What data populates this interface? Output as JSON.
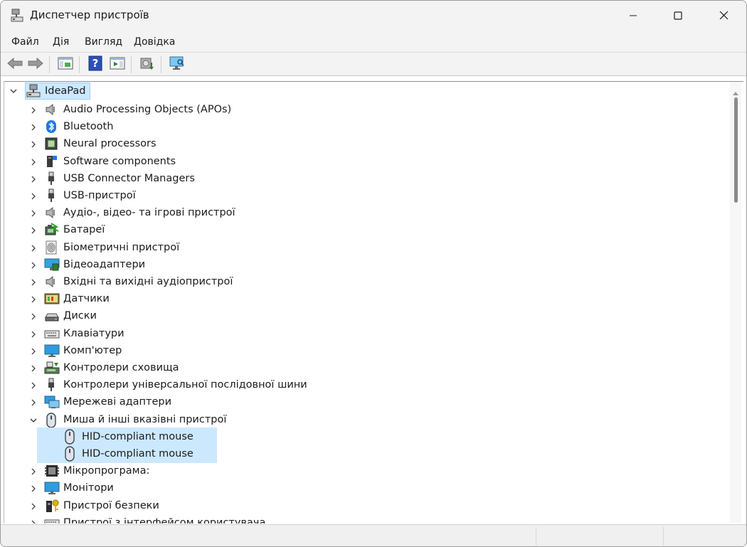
{
  "window": {
    "title": "Диспетчер пристроїв"
  },
  "menu": {
    "items": [
      "Файл",
      "Дія",
      "Вигляд",
      "Довідка"
    ]
  },
  "tree": {
    "root": {
      "label": "IdeaPad",
      "icon": "computer-network-icon"
    },
    "categories": [
      {
        "label": "Audio Processing Objects (APOs)",
        "icon": "speaker-icon",
        "expanded": false
      },
      {
        "label": "Bluetooth",
        "icon": "bluetooth-icon",
        "expanded": false
      },
      {
        "label": "Neural processors",
        "icon": "chip-icon",
        "expanded": false
      },
      {
        "label": "Software components",
        "icon": "software-component-icon",
        "expanded": false
      },
      {
        "label": "USB Connector Managers",
        "icon": "usb-icon",
        "expanded": false
      },
      {
        "label": "USB-пристрої",
        "icon": "usb-icon",
        "expanded": false
      },
      {
        "label": "Аудіо-, відео- та ігрові пристрої",
        "icon": "speaker-icon",
        "expanded": false
      },
      {
        "label": "Батареї",
        "icon": "battery-icon",
        "expanded": false
      },
      {
        "label": "Біометричні пристрої",
        "icon": "fingerprint-icon",
        "expanded": false
      },
      {
        "label": "Відеоадаптери",
        "icon": "display-adapter-icon",
        "expanded": false
      },
      {
        "label": "Вхідні та вихідні аудіопристрої",
        "icon": "speaker-icon",
        "expanded": false
      },
      {
        "label": "Датчики",
        "icon": "sensor-icon",
        "expanded": false
      },
      {
        "label": "Диски",
        "icon": "disk-icon",
        "expanded": false
      },
      {
        "label": "Клавіатури",
        "icon": "keyboard-icon",
        "expanded": false
      },
      {
        "label": "Комп'ютер",
        "icon": "monitor-icon",
        "expanded": false
      },
      {
        "label": "Контролери сховища",
        "icon": "storage-controller-icon",
        "expanded": false
      },
      {
        "label": "Контролери універсальної послідовної шини",
        "icon": "usb-icon",
        "expanded": false
      },
      {
        "label": "Мережеві адаптери",
        "icon": "network-adapter-icon",
        "expanded": false
      },
      {
        "label": "Миша й інші вказівні пристрої",
        "icon": "mouse-icon",
        "expanded": true,
        "children": [
          {
            "label": "HID-compliant mouse",
            "icon": "mouse-icon"
          },
          {
            "label": "HID-compliant mouse",
            "icon": "mouse-icon"
          }
        ]
      },
      {
        "label": "Мікропрограма:",
        "icon": "firmware-icon",
        "expanded": false
      },
      {
        "label": "Монітори",
        "icon": "monitor-icon",
        "expanded": false
      },
      {
        "label": "Пристрої безпеки",
        "icon": "security-key-icon",
        "expanded": false
      },
      {
        "label": "Пристрої з інтерфейсом користувача",
        "icon": "keyboard-icon",
        "expanded": false
      }
    ]
  },
  "colors": {
    "selection": "#cce8ff",
    "chrome": "#f3f3f3"
  }
}
